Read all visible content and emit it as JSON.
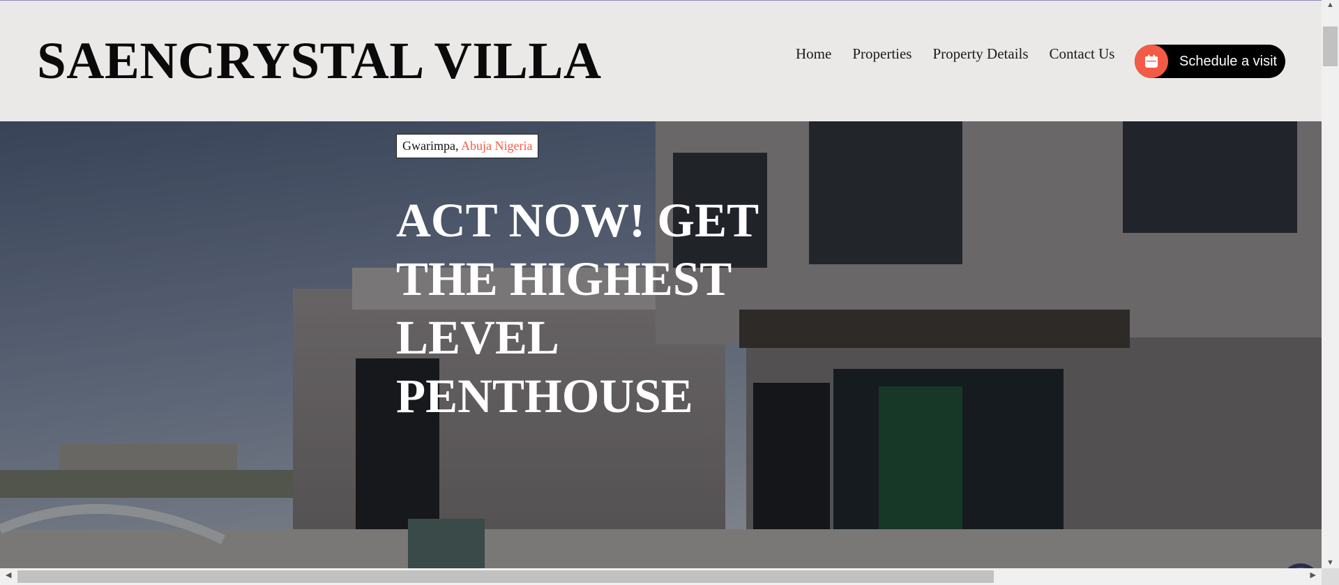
{
  "brand": {
    "name": "SAENCRYSTAL VILLA"
  },
  "nav": {
    "items": [
      {
        "label": "Home"
      },
      {
        "label": "Properties"
      },
      {
        "label": "Property Details"
      },
      {
        "label": "Contact Us"
      }
    ],
    "cta_label": "Schedule a visit",
    "cta_icon": "calendar-icon"
  },
  "hero": {
    "location_prefix": "Gwarimpa,",
    "location_accent": "Abuja Nigeria",
    "headline": "ACT NOW! GET THE HIGHEST LEVEL PENTHOUSE",
    "chat_icon": "chat-assistant-icon"
  },
  "colors": {
    "accent": "#f45b47",
    "header_bg": "#ebe9e8",
    "cta_bg": "#000000"
  }
}
